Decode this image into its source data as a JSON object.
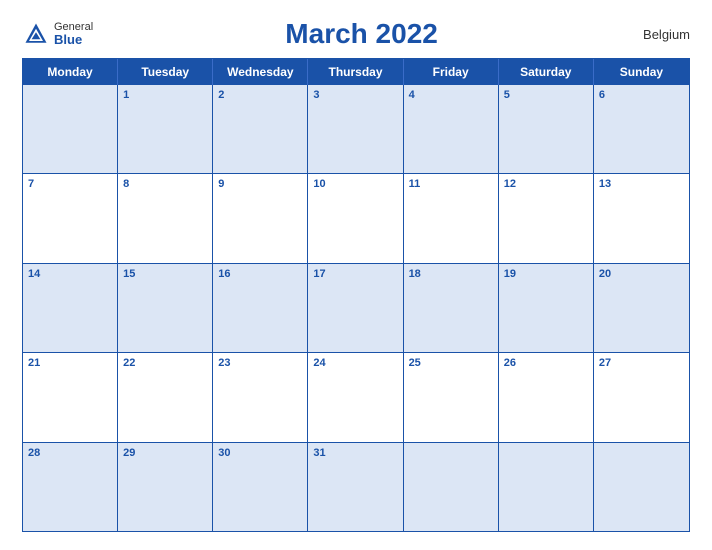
{
  "logo": {
    "general": "General",
    "blue": "Blue"
  },
  "title": "March 2022",
  "country": "Belgium",
  "days": [
    "Monday",
    "Tuesday",
    "Wednesday",
    "Thursday",
    "Friday",
    "Saturday",
    "Sunday"
  ],
  "weeks": [
    [
      null,
      1,
      2,
      3,
      4,
      5,
      6
    ],
    [
      7,
      8,
      9,
      10,
      11,
      12,
      13
    ],
    [
      14,
      15,
      16,
      17,
      18,
      19,
      20
    ],
    [
      21,
      22,
      23,
      24,
      25,
      26,
      27
    ],
    [
      28,
      29,
      30,
      31,
      null,
      null,
      null
    ]
  ]
}
